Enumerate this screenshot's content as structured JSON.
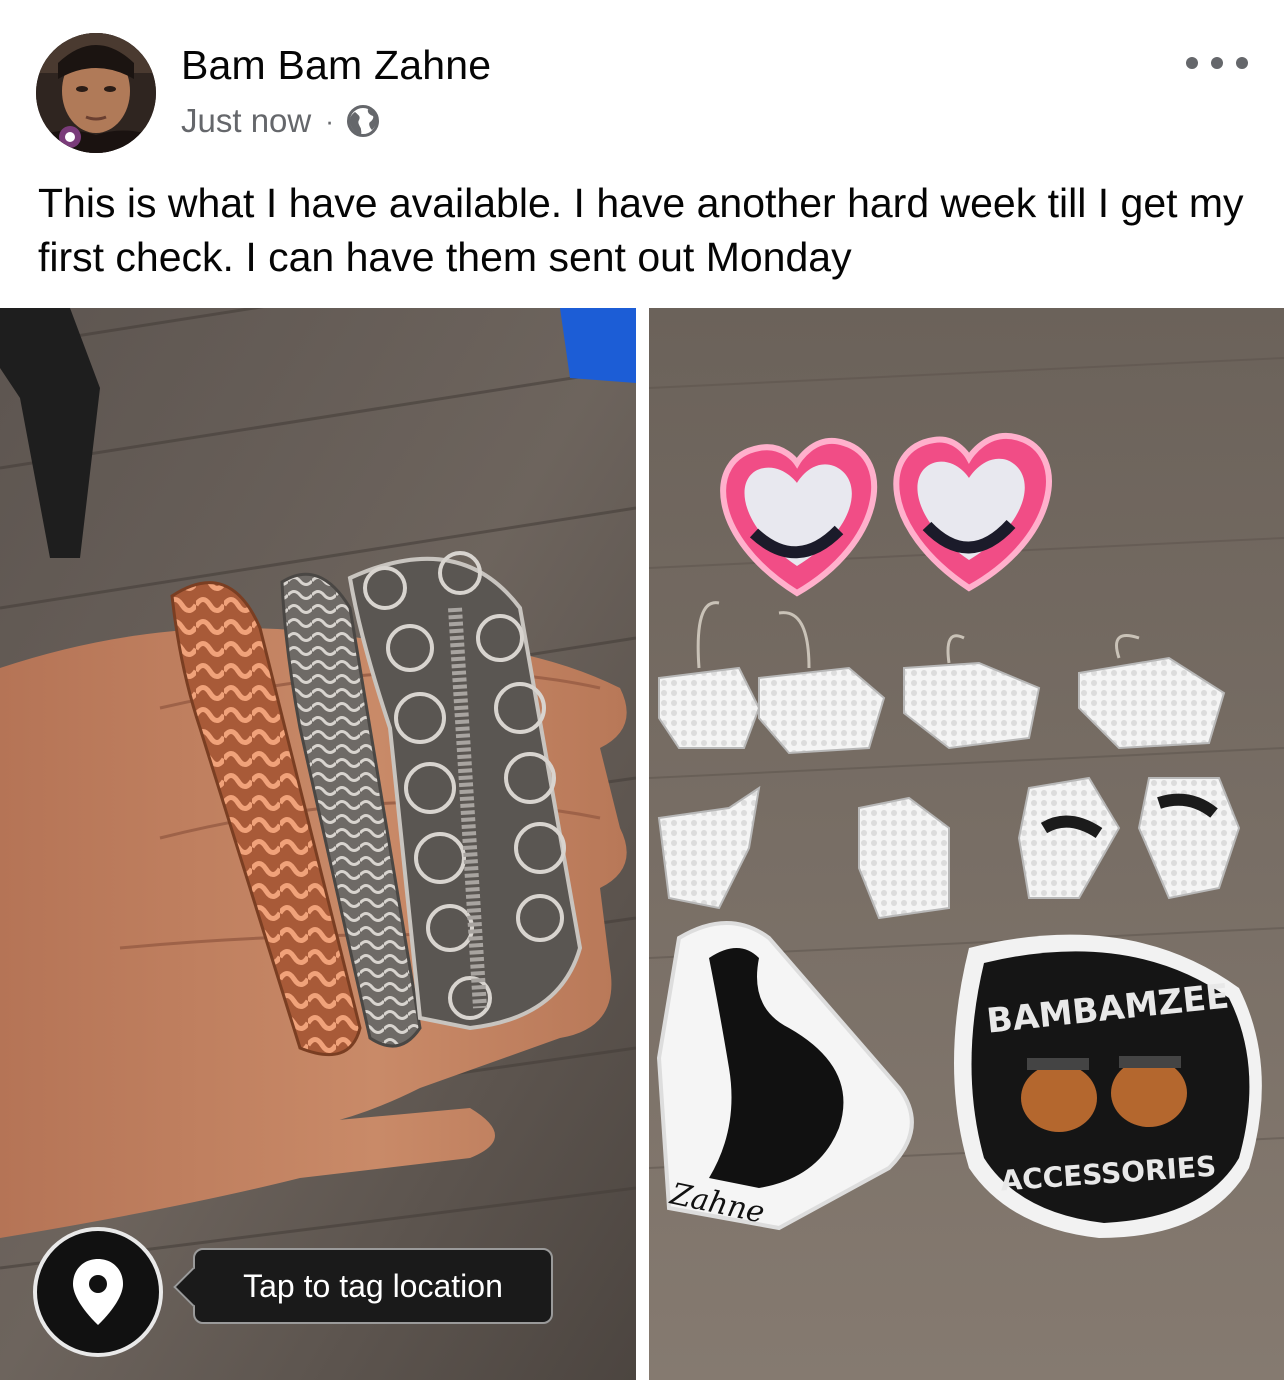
{
  "post": {
    "author": "Bam Bam Zahne",
    "timestamp": "Just now",
    "separator": "·",
    "audience_icon": "globe-icon",
    "more_icon": "more-options-icon",
    "text": "This is what I have available. I have another hard week till I get my first check. I can have them sent out Monday"
  },
  "photos": [
    {
      "name": "bracelets-photo"
    },
    {
      "name": "earrings-stickers-photo"
    }
  ],
  "sticker_text": {
    "brand_top": "BAMBAMZEE",
    "brand_bottom": "ACCESSORIES",
    "zahne": "Zahne"
  },
  "location_tag": {
    "icon": "location-pin-icon",
    "label": "Tap to tag location"
  },
  "colors": {
    "name_text": "#050505",
    "meta_text": "#65676b",
    "tooltip_bg": "#1a1a1a"
  }
}
